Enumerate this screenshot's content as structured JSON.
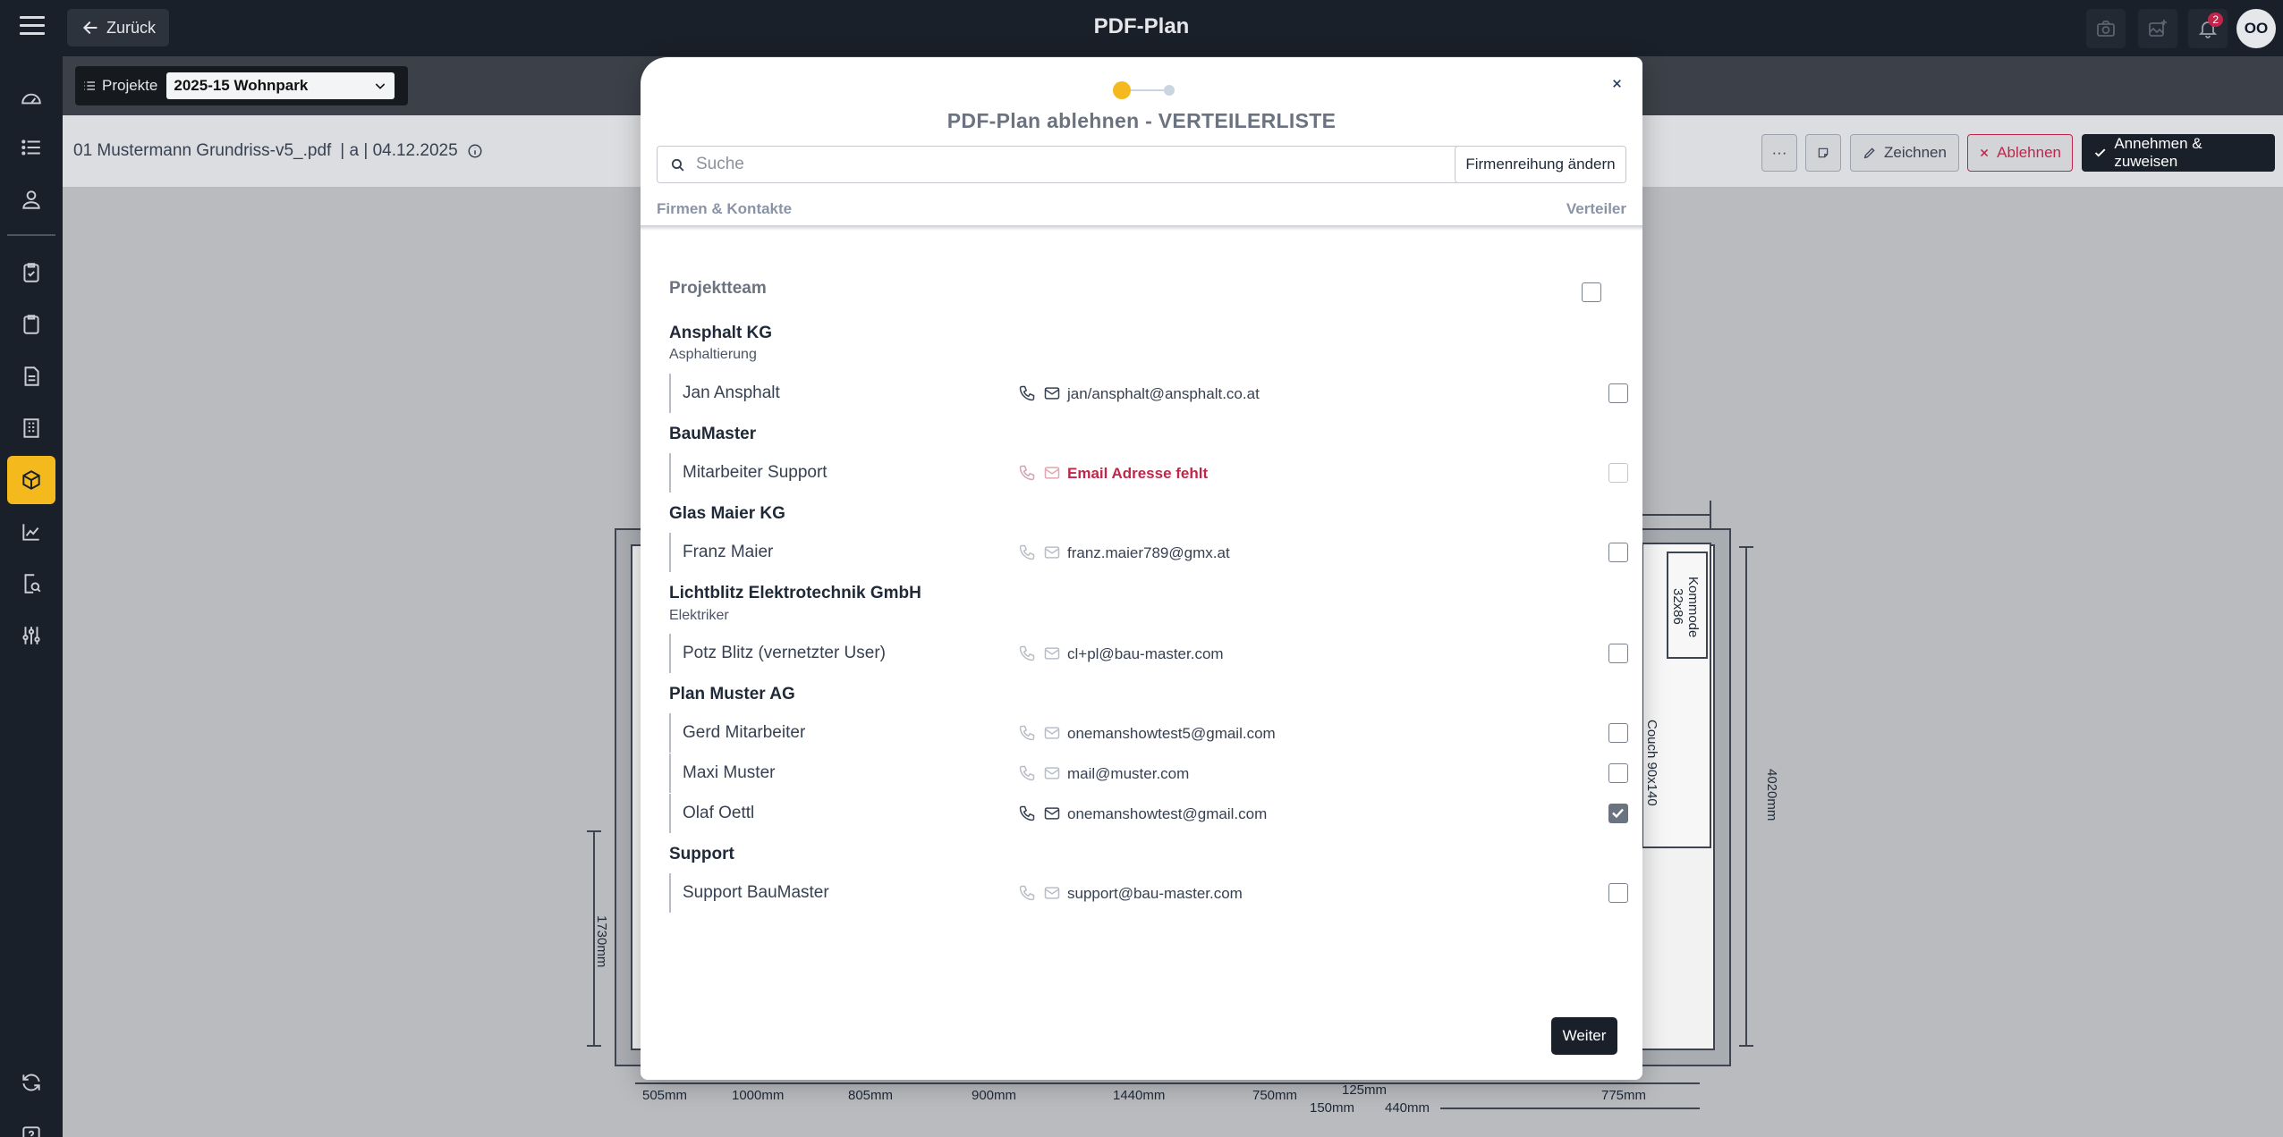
{
  "app": {
    "title": "PDF-Plan",
    "back_label": "Zurück",
    "notification_count": "2",
    "avatar_initials": "OO"
  },
  "project": {
    "label": "Projekte",
    "selected": "2025-15 Wohnpark"
  },
  "file": {
    "name": "01 Mustermann Grundriss-v5_.pdf",
    "meta": "| a | 04.12.2025"
  },
  "toolbar": {
    "more": "···",
    "draw": "Zeichnen",
    "reject": "Ablehnen",
    "accept": "Annehmen & zuweisen"
  },
  "plan_labels": {
    "kommode": "Kommode",
    "kommode_size": "32x86",
    "couch": "Couch 90x140",
    "dim_4020": "4020mm",
    "dim_1730": "1730mm",
    "bottom": [
      "505mm",
      "1000mm",
      "805mm",
      "900mm",
      "1440mm",
      "750mm",
      "125mm",
      "150mm",
      "440mm",
      "775mm"
    ]
  },
  "modal": {
    "title": "PDF-Plan ablehnen - VERTEILERLISTE",
    "search_placeholder": "Suche",
    "order_button": "Firmenreihung ändern",
    "header_left": "Firmen & Kontakte",
    "header_right": "Verteiler",
    "team_label": "Projektteam",
    "next_button": "Weiter",
    "groups": [
      {
        "name": "Ansphalt KG",
        "sub": "Asphaltierung",
        "contacts": [
          {
            "name": "Jan Ansphalt",
            "email": "jan/ansphalt@ansphalt.co.at",
            "checked": false
          }
        ]
      },
      {
        "name": "BauMaster",
        "sub": "",
        "contacts": [
          {
            "name": "Mitarbeiter Support",
            "email": "Email Adresse fehlt",
            "checked": false
          }
        ]
      },
      {
        "name": "Glas Maier KG",
        "sub": "",
        "contacts": [
          {
            "name": "Franz Maier",
            "email": "franz.maier789@gmx.at",
            "checked": false
          }
        ]
      },
      {
        "name": "Lichtblitz Elektrotechnik GmbH",
        "sub": "Elektriker",
        "contacts": [
          {
            "name": "Potz Blitz (vernetzter User)",
            "email": "cl+pl@bau-master.com",
            "checked": false
          }
        ]
      },
      {
        "name": "Plan Muster AG",
        "sub": "",
        "contacts": [
          {
            "name": "Gerd Mitarbeiter",
            "email": "onemanshowtest5@gmail.com",
            "checked": false
          },
          {
            "name": "Maxi Muster",
            "email": "mail@muster.com",
            "checked": false
          },
          {
            "name": "Olaf Oettl",
            "email": "onemanshowtest@gmail.com",
            "checked": true
          }
        ]
      },
      {
        "name": "Support",
        "sub": "",
        "contacts": [
          {
            "name": "Support BauMaster",
            "email": "support@bau-master.com",
            "checked": false
          }
        ]
      }
    ]
  },
  "colors": {
    "dark": "#1a2029",
    "accent": "#f3b91d",
    "danger": "#c0264b"
  }
}
